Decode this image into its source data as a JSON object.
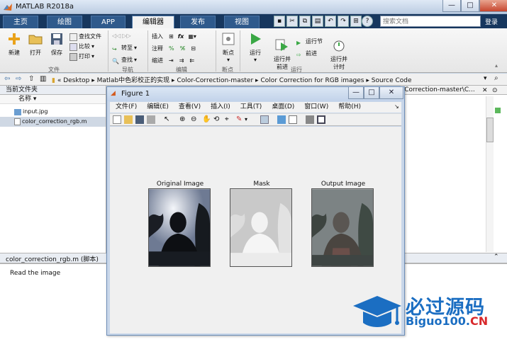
{
  "app": {
    "title": "MATLAB R2018a"
  },
  "window_controls": {
    "minimize": "—",
    "maximize": "□",
    "close": "✕"
  },
  "tabs": [
    {
      "label": "主页"
    },
    {
      "label": "绘图"
    },
    {
      "label": "APP"
    },
    {
      "label": "编辑器"
    },
    {
      "label": "发布"
    },
    {
      "label": "视图"
    }
  ],
  "search": {
    "placeholder": "搜索文档"
  },
  "login": "登录",
  "ribbon": {
    "file": {
      "new": "新建",
      "open": "打开",
      "save": "保存",
      "find_files": "查找文件",
      "compare": "比较",
      "print": "打印",
      "group": "文件"
    },
    "navigate": {
      "goto": "转至",
      "find": "查找",
      "group": "导航"
    },
    "edit": {
      "insert": "插入",
      "comment": "注释",
      "indent": "缩进",
      "fx": "fx",
      "group": "编辑"
    },
    "breakpoints": {
      "label": "断点",
      "group": "断点"
    },
    "run": {
      "run": "运行",
      "run_advance": "运行并\n前进",
      "run_section": "运行节",
      "advance": "前进",
      "run_time": "运行并\n计时",
      "group": "运行"
    }
  },
  "address": {
    "segments": [
      "Desktop",
      "Matlab中色彩校正的实现",
      "Color-Correction-master",
      "Color Correction for RGB images",
      "Source Code"
    ]
  },
  "current_folder": {
    "title": "当前文件夹",
    "column": "名称",
    "files": [
      {
        "name": "input.jpg",
        "selected": false
      },
      {
        "name": "color_correction_rgb.m",
        "selected": true
      }
    ]
  },
  "editor_tab": "-Correction-master\\C...",
  "detail": {
    "title": "color_correction_rgb.m  (脚本)",
    "text": "Read the image"
  },
  "figure": {
    "title": "Figure 1",
    "menu": [
      "文件(F)",
      "编辑(E)",
      "查看(V)",
      "插入(I)",
      "工具(T)",
      "桌面(D)",
      "窗口(W)",
      "帮助(H)"
    ],
    "plots": [
      {
        "title": "Original Image"
      },
      {
        "title": "Mask"
      },
      {
        "title": "Output Image"
      }
    ]
  },
  "watermark": {
    "brand": "必过源码",
    "site_a": "Biguo100.",
    "site_b": "CN"
  },
  "colors": {
    "ribbon_bar": "#17375e",
    "accent": "#1b6ec2",
    "watermark_red": "#d8282b"
  }
}
